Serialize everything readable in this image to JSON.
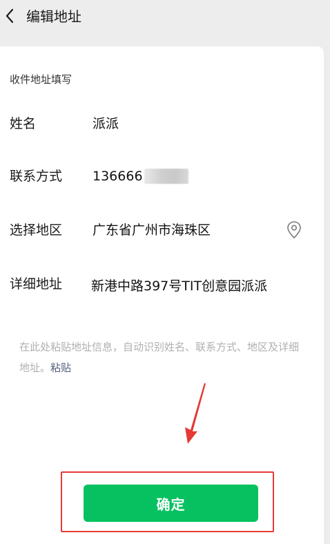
{
  "header": {
    "back_icon": "chevron-left-icon",
    "title": "编辑地址"
  },
  "form": {
    "section_title": "收件地址填写",
    "name_label": "姓名",
    "name_value": "派派",
    "phone_label": "联系方式",
    "phone_value_visible": "136666",
    "region_label": "选择地区",
    "region_value": "广东省广州市海珠区",
    "region_icon": "location-pin-icon",
    "address_label": "详细地址",
    "address_value": "新港中路397号TIT创意园派派"
  },
  "hint": {
    "text": "在此处粘贴地址信息，自动识别姓名、联系方式、地区及详细地址。",
    "paste_link": "粘贴"
  },
  "footer": {
    "confirm_label": "确定",
    "confirm_color": "#07c160",
    "annotation_color": "#e53935"
  }
}
